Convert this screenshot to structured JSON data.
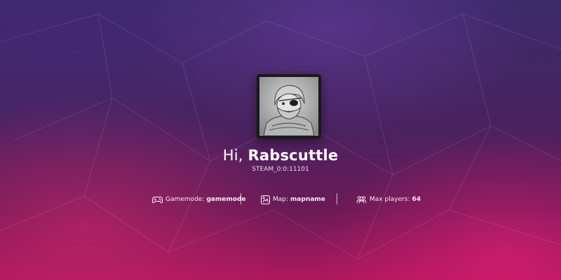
{
  "profile": {
    "greeting": "Hi,",
    "username": "Rabscuttle",
    "steam_id": "STEAM_0:0:11101",
    "avatar_icon": "avatar-portrait"
  },
  "server_info": [
    {
      "icon": "gamepad-icon",
      "label": "Gamemode:",
      "value": "gamemode"
    },
    {
      "icon": "map-icon",
      "label": "Map:",
      "value": "mapname"
    },
    {
      "icon": "players-icon",
      "label": "Max players:",
      "value": "64"
    }
  ],
  "colors": {
    "background_top": "#3a2a6a",
    "background_bottom": "#b0185e",
    "text": "#ffffff"
  }
}
